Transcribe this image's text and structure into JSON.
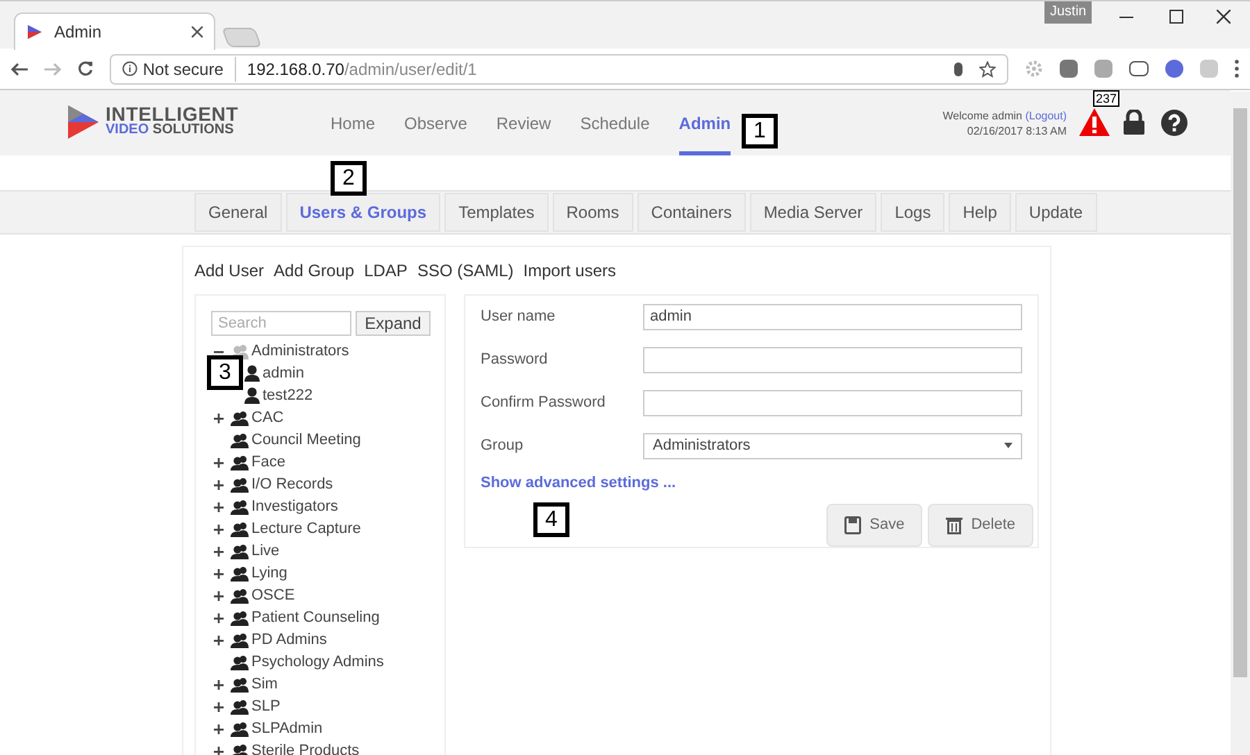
{
  "browser": {
    "tab_title": "Admin",
    "profile": "Justin",
    "security": "Not secure",
    "url_host": "192.168.0.70",
    "url_path": "/admin/user/edit/1"
  },
  "header": {
    "logo_line1": "INTELLIGENT",
    "logo_line2a": "VIDEO",
    "logo_line2b": "SOLUTIONS",
    "nav": [
      {
        "label": "Home",
        "selected": false
      },
      {
        "label": "Observe",
        "selected": false
      },
      {
        "label": "Review",
        "selected": false
      },
      {
        "label": "Schedule",
        "selected": false
      },
      {
        "label": "Admin",
        "selected": true
      }
    ],
    "welcome": "Welcome admin",
    "logout": "(Logout)",
    "datetime": "02/16/2017 8:13 AM",
    "alert_count": "237"
  },
  "subnav": [
    {
      "label": "General",
      "selected": false
    },
    {
      "label": "Users & Groups",
      "selected": true
    },
    {
      "label": "Templates",
      "selected": false
    },
    {
      "label": "Rooms",
      "selected": false
    },
    {
      "label": "Containers",
      "selected": false
    },
    {
      "label": "Media Server",
      "selected": false
    },
    {
      "label": "Logs",
      "selected": false
    },
    {
      "label": "Help",
      "selected": false
    },
    {
      "label": "Update",
      "selected": false
    }
  ],
  "actions": [
    "Add User",
    "Add Group",
    "LDAP",
    "SSO (SAML)",
    "Import users"
  ],
  "tree": {
    "search_placeholder": "Search",
    "expand_button": "Expand",
    "groups": [
      {
        "kind": "expandable",
        "label": "Administrators",
        "expanded": true,
        "selected": true,
        "children": [
          {
            "label": "admin"
          },
          {
            "label": "test222"
          }
        ]
      },
      {
        "kind": "expandable",
        "label": "CAC",
        "expanded": false,
        "selected": false
      },
      {
        "kind": "leaf",
        "label": "Council Meeting",
        "selected": false
      },
      {
        "kind": "expandable",
        "label": "Face",
        "expanded": false,
        "selected": false
      },
      {
        "kind": "expandable",
        "label": "I/O Records",
        "expanded": false,
        "selected": false
      },
      {
        "kind": "expandable",
        "label": "Investigators",
        "expanded": false,
        "selected": false
      },
      {
        "kind": "expandable",
        "label": "Lecture Capture",
        "expanded": false,
        "selected": false
      },
      {
        "kind": "expandable",
        "label": "Live",
        "expanded": false,
        "selected": false
      },
      {
        "kind": "expandable",
        "label": "Lying",
        "expanded": false,
        "selected": false
      },
      {
        "kind": "expandable",
        "label": "OSCE",
        "expanded": false,
        "selected": false
      },
      {
        "kind": "expandable",
        "label": "Patient Counseling",
        "expanded": false,
        "selected": false
      },
      {
        "kind": "expandable",
        "label": "PD Admins",
        "expanded": false,
        "selected": false
      },
      {
        "kind": "leaf",
        "label": "Psychology Admins",
        "selected": false
      },
      {
        "kind": "expandable",
        "label": "Sim",
        "expanded": false,
        "selected": false
      },
      {
        "kind": "expandable",
        "label": "SLP",
        "expanded": false,
        "selected": false
      },
      {
        "kind": "expandable",
        "label": "SLPAdmin",
        "expanded": false,
        "selected": false
      },
      {
        "kind": "expandable",
        "label": "Sterile Products",
        "expanded": false,
        "selected": false
      }
    ]
  },
  "form": {
    "fields": [
      {
        "kind": "text",
        "label": "User name",
        "value": "admin"
      },
      {
        "kind": "password",
        "label": "Password"
      },
      {
        "kind": "password",
        "label": "Confirm Password"
      },
      {
        "kind": "select",
        "label": "Group",
        "value": "Administrators"
      }
    ],
    "advanced_link": "Show advanced settings ...",
    "buttons": [
      {
        "kind": "save",
        "label": "Save"
      },
      {
        "kind": "delete",
        "label": "Delete"
      }
    ]
  },
  "callouts": [
    "1",
    "2",
    "3",
    "4"
  ]
}
